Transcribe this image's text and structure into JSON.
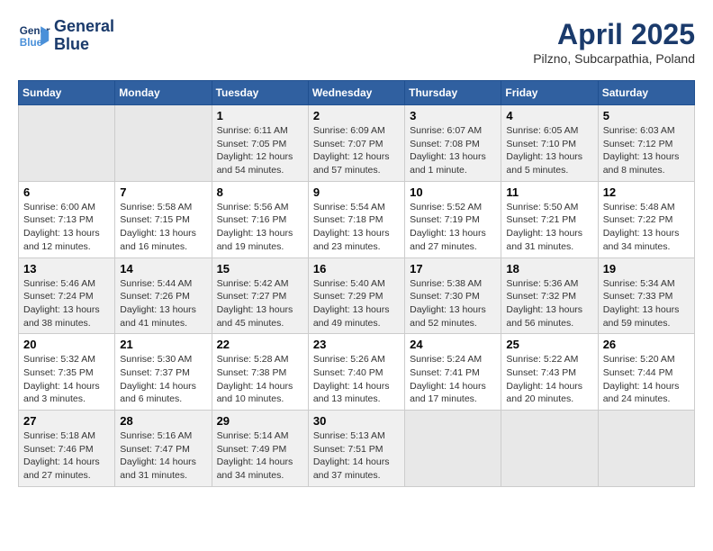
{
  "header": {
    "logo_line1": "General",
    "logo_line2": "Blue",
    "month_title": "April 2025",
    "subtitle": "Pilzno, Subcarpathia, Poland"
  },
  "weekdays": [
    "Sunday",
    "Monday",
    "Tuesday",
    "Wednesday",
    "Thursday",
    "Friday",
    "Saturday"
  ],
  "weeks": [
    [
      {
        "day": "",
        "info": ""
      },
      {
        "day": "",
        "info": ""
      },
      {
        "day": "1",
        "info": "Sunrise: 6:11 AM\nSunset: 7:05 PM\nDaylight: 12 hours\nand 54 minutes."
      },
      {
        "day": "2",
        "info": "Sunrise: 6:09 AM\nSunset: 7:07 PM\nDaylight: 12 hours\nand 57 minutes."
      },
      {
        "day": "3",
        "info": "Sunrise: 6:07 AM\nSunset: 7:08 PM\nDaylight: 13 hours\nand 1 minute."
      },
      {
        "day": "4",
        "info": "Sunrise: 6:05 AM\nSunset: 7:10 PM\nDaylight: 13 hours\nand 5 minutes."
      },
      {
        "day": "5",
        "info": "Sunrise: 6:03 AM\nSunset: 7:12 PM\nDaylight: 13 hours\nand 8 minutes."
      }
    ],
    [
      {
        "day": "6",
        "info": "Sunrise: 6:00 AM\nSunset: 7:13 PM\nDaylight: 13 hours\nand 12 minutes."
      },
      {
        "day": "7",
        "info": "Sunrise: 5:58 AM\nSunset: 7:15 PM\nDaylight: 13 hours\nand 16 minutes."
      },
      {
        "day": "8",
        "info": "Sunrise: 5:56 AM\nSunset: 7:16 PM\nDaylight: 13 hours\nand 19 minutes."
      },
      {
        "day": "9",
        "info": "Sunrise: 5:54 AM\nSunset: 7:18 PM\nDaylight: 13 hours\nand 23 minutes."
      },
      {
        "day": "10",
        "info": "Sunrise: 5:52 AM\nSunset: 7:19 PM\nDaylight: 13 hours\nand 27 minutes."
      },
      {
        "day": "11",
        "info": "Sunrise: 5:50 AM\nSunset: 7:21 PM\nDaylight: 13 hours\nand 31 minutes."
      },
      {
        "day": "12",
        "info": "Sunrise: 5:48 AM\nSunset: 7:22 PM\nDaylight: 13 hours\nand 34 minutes."
      }
    ],
    [
      {
        "day": "13",
        "info": "Sunrise: 5:46 AM\nSunset: 7:24 PM\nDaylight: 13 hours\nand 38 minutes."
      },
      {
        "day": "14",
        "info": "Sunrise: 5:44 AM\nSunset: 7:26 PM\nDaylight: 13 hours\nand 41 minutes."
      },
      {
        "day": "15",
        "info": "Sunrise: 5:42 AM\nSunset: 7:27 PM\nDaylight: 13 hours\nand 45 minutes."
      },
      {
        "day": "16",
        "info": "Sunrise: 5:40 AM\nSunset: 7:29 PM\nDaylight: 13 hours\nand 49 minutes."
      },
      {
        "day": "17",
        "info": "Sunrise: 5:38 AM\nSunset: 7:30 PM\nDaylight: 13 hours\nand 52 minutes."
      },
      {
        "day": "18",
        "info": "Sunrise: 5:36 AM\nSunset: 7:32 PM\nDaylight: 13 hours\nand 56 minutes."
      },
      {
        "day": "19",
        "info": "Sunrise: 5:34 AM\nSunset: 7:33 PM\nDaylight: 13 hours\nand 59 minutes."
      }
    ],
    [
      {
        "day": "20",
        "info": "Sunrise: 5:32 AM\nSunset: 7:35 PM\nDaylight: 14 hours\nand 3 minutes."
      },
      {
        "day": "21",
        "info": "Sunrise: 5:30 AM\nSunset: 7:37 PM\nDaylight: 14 hours\nand 6 minutes."
      },
      {
        "day": "22",
        "info": "Sunrise: 5:28 AM\nSunset: 7:38 PM\nDaylight: 14 hours\nand 10 minutes."
      },
      {
        "day": "23",
        "info": "Sunrise: 5:26 AM\nSunset: 7:40 PM\nDaylight: 14 hours\nand 13 minutes."
      },
      {
        "day": "24",
        "info": "Sunrise: 5:24 AM\nSunset: 7:41 PM\nDaylight: 14 hours\nand 17 minutes."
      },
      {
        "day": "25",
        "info": "Sunrise: 5:22 AM\nSunset: 7:43 PM\nDaylight: 14 hours\nand 20 minutes."
      },
      {
        "day": "26",
        "info": "Sunrise: 5:20 AM\nSunset: 7:44 PM\nDaylight: 14 hours\nand 24 minutes."
      }
    ],
    [
      {
        "day": "27",
        "info": "Sunrise: 5:18 AM\nSunset: 7:46 PM\nDaylight: 14 hours\nand 27 minutes."
      },
      {
        "day": "28",
        "info": "Sunrise: 5:16 AM\nSunset: 7:47 PM\nDaylight: 14 hours\nand 31 minutes."
      },
      {
        "day": "29",
        "info": "Sunrise: 5:14 AM\nSunset: 7:49 PM\nDaylight: 14 hours\nand 34 minutes."
      },
      {
        "day": "30",
        "info": "Sunrise: 5:13 AM\nSunset: 7:51 PM\nDaylight: 14 hours\nand 37 minutes."
      },
      {
        "day": "",
        "info": ""
      },
      {
        "day": "",
        "info": ""
      },
      {
        "day": "",
        "info": ""
      }
    ]
  ]
}
